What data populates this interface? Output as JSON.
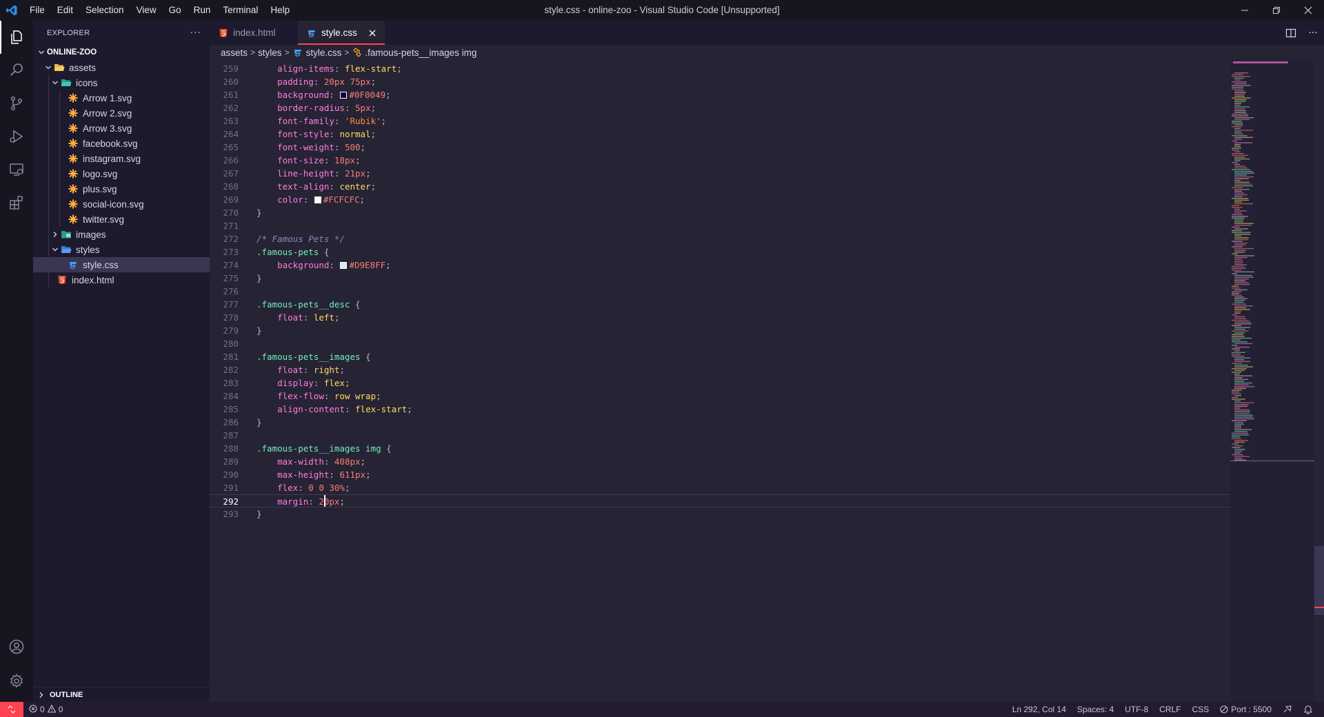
{
  "window": {
    "title": "style.css - online-zoo - Visual Studio Code [Unsupported]",
    "menu": [
      "File",
      "Edit",
      "Selection",
      "View",
      "Go",
      "Run",
      "Terminal",
      "Help"
    ]
  },
  "colors": {
    "accent": "#fe4450",
    "background": "#262335",
    "sidebar": "#1e1a2e",
    "activitybar": "#171520"
  },
  "sidebar": {
    "title": "EXPLORER",
    "root": "ONLINE-ZOO",
    "tree": {
      "assets": "assets",
      "icons": "icons",
      "icon_files": [
        "Arrow 1.svg",
        "Arrow 2.svg",
        "Arrow 3.svg",
        "facebook.svg",
        "instagram.svg",
        "logo.svg",
        "plus.svg",
        "social-icon.svg",
        "twitter.svg"
      ],
      "images": "images",
      "styles": "styles",
      "style_file": "style.css",
      "index_file": "index.html"
    },
    "outline": "OUTLINE"
  },
  "tabs": [
    {
      "label": "index.html",
      "active": false
    },
    {
      "label": "style.css",
      "active": true
    }
  ],
  "breadcrumb": [
    "assets",
    "styles",
    "style.css",
    ".famous-pets__images img"
  ],
  "editor": {
    "current_line": 292,
    "lines": [
      {
        "n": 259,
        "tokens": [
          {
            "t": "    "
          },
          {
            "t": "align-items",
            "c": "prop"
          },
          {
            "t": ": ",
            "c": "punc"
          },
          {
            "t": "flex-start",
            "c": "val"
          },
          {
            "t": ";",
            "c": "punc"
          }
        ]
      },
      {
        "n": 260,
        "tokens": [
          {
            "t": "    "
          },
          {
            "t": "padding",
            "c": "prop"
          },
          {
            "t": ": ",
            "c": "punc"
          },
          {
            "t": "20px 75px",
            "c": "num"
          },
          {
            "t": ";",
            "c": "punc"
          }
        ]
      },
      {
        "n": 261,
        "tokens": [
          {
            "t": "    "
          },
          {
            "t": "background",
            "c": "prop"
          },
          {
            "t": ": ",
            "c": "punc"
          },
          {
            "swatch": "#0F0049"
          },
          {
            "t": "#0F0049",
            "c": "num"
          },
          {
            "t": ";",
            "c": "punc"
          }
        ]
      },
      {
        "n": 262,
        "tokens": [
          {
            "t": "    "
          },
          {
            "t": "border-radius",
            "c": "prop"
          },
          {
            "t": ": ",
            "c": "punc"
          },
          {
            "t": "5px",
            "c": "num"
          },
          {
            "t": ";",
            "c": "punc"
          }
        ]
      },
      {
        "n": 263,
        "tokens": [
          {
            "t": "    "
          },
          {
            "t": "font-family",
            "c": "prop"
          },
          {
            "t": ": ",
            "c": "punc"
          },
          {
            "t": "'Rubik'",
            "c": "str"
          },
          {
            "t": ";",
            "c": "punc"
          }
        ]
      },
      {
        "n": 264,
        "tokens": [
          {
            "t": "    "
          },
          {
            "t": "font-style",
            "c": "prop"
          },
          {
            "t": ": ",
            "c": "punc"
          },
          {
            "t": "normal",
            "c": "val"
          },
          {
            "t": ";",
            "c": "punc"
          }
        ]
      },
      {
        "n": 265,
        "tokens": [
          {
            "t": "    "
          },
          {
            "t": "font-weight",
            "c": "prop"
          },
          {
            "t": ": ",
            "c": "punc"
          },
          {
            "t": "500",
            "c": "num"
          },
          {
            "t": ";",
            "c": "punc"
          }
        ]
      },
      {
        "n": 266,
        "tokens": [
          {
            "t": "    "
          },
          {
            "t": "font-size",
            "c": "prop"
          },
          {
            "t": ": ",
            "c": "punc"
          },
          {
            "t": "18px",
            "c": "num"
          },
          {
            "t": ";",
            "c": "punc"
          }
        ]
      },
      {
        "n": 267,
        "tokens": [
          {
            "t": "    "
          },
          {
            "t": "line-height",
            "c": "prop"
          },
          {
            "t": ": ",
            "c": "punc"
          },
          {
            "t": "21px",
            "c": "num"
          },
          {
            "t": ";",
            "c": "punc"
          }
        ]
      },
      {
        "n": 268,
        "tokens": [
          {
            "t": "    "
          },
          {
            "t": "text-align",
            "c": "prop"
          },
          {
            "t": ": ",
            "c": "punc"
          },
          {
            "t": "center",
            "c": "val"
          },
          {
            "t": ";",
            "c": "punc"
          }
        ]
      },
      {
        "n": 269,
        "tokens": [
          {
            "t": "    "
          },
          {
            "t": "color",
            "c": "prop"
          },
          {
            "t": ": ",
            "c": "punc"
          },
          {
            "swatch": "#FCFCFC"
          },
          {
            "t": "#FCFCFC",
            "c": "num"
          },
          {
            "t": ";",
            "c": "punc"
          }
        ]
      },
      {
        "n": 270,
        "tokens": [
          {
            "t": "}",
            "c": "punc"
          }
        ]
      },
      {
        "n": 271,
        "tokens": []
      },
      {
        "n": 272,
        "tokens": [
          {
            "t": "/* Famous Pets */",
            "c": "com"
          }
        ]
      },
      {
        "n": 273,
        "tokens": [
          {
            "t": ".famous-pets",
            "c": "sel"
          },
          {
            "t": " {",
            "c": "punc"
          }
        ]
      },
      {
        "n": 274,
        "tokens": [
          {
            "t": "    "
          },
          {
            "t": "background",
            "c": "prop"
          },
          {
            "t": ": ",
            "c": "punc"
          },
          {
            "swatch": "#D9E8FF"
          },
          {
            "t": "#D9E8FF",
            "c": "num"
          },
          {
            "t": ";",
            "c": "punc"
          }
        ]
      },
      {
        "n": 275,
        "tokens": [
          {
            "t": "}",
            "c": "punc"
          }
        ]
      },
      {
        "n": 276,
        "tokens": []
      },
      {
        "n": 277,
        "tokens": [
          {
            "t": ".famous-pets__desc",
            "c": "sel"
          },
          {
            "t": " {",
            "c": "punc"
          }
        ]
      },
      {
        "n": 278,
        "tokens": [
          {
            "t": "    "
          },
          {
            "t": "float",
            "c": "prop"
          },
          {
            "t": ": ",
            "c": "punc"
          },
          {
            "t": "left",
            "c": "val"
          },
          {
            "t": ";",
            "c": "punc"
          }
        ]
      },
      {
        "n": 279,
        "tokens": [
          {
            "t": "}",
            "c": "punc"
          }
        ]
      },
      {
        "n": 280,
        "tokens": []
      },
      {
        "n": 281,
        "tokens": [
          {
            "t": ".famous-pets__images",
            "c": "sel"
          },
          {
            "t": " {",
            "c": "punc"
          }
        ]
      },
      {
        "n": 282,
        "tokens": [
          {
            "t": "    "
          },
          {
            "t": "float",
            "c": "prop"
          },
          {
            "t": ": ",
            "c": "punc"
          },
          {
            "t": "right",
            "c": "val"
          },
          {
            "t": ";",
            "c": "punc"
          }
        ]
      },
      {
        "n": 283,
        "tokens": [
          {
            "t": "    "
          },
          {
            "t": "display",
            "c": "prop"
          },
          {
            "t": ": ",
            "c": "punc"
          },
          {
            "t": "flex",
            "c": "val"
          },
          {
            "t": ";",
            "c": "punc"
          }
        ]
      },
      {
        "n": 284,
        "tokens": [
          {
            "t": "    "
          },
          {
            "t": "flex-flow",
            "c": "prop"
          },
          {
            "t": ": ",
            "c": "punc"
          },
          {
            "t": "row wrap",
            "c": "val"
          },
          {
            "t": ";",
            "c": "punc"
          }
        ]
      },
      {
        "n": 285,
        "tokens": [
          {
            "t": "    "
          },
          {
            "t": "align-content",
            "c": "prop"
          },
          {
            "t": ": ",
            "c": "punc"
          },
          {
            "t": "flex-start",
            "c": "val"
          },
          {
            "t": ";",
            "c": "punc"
          }
        ]
      },
      {
        "n": 286,
        "tokens": [
          {
            "t": "}",
            "c": "punc"
          }
        ]
      },
      {
        "n": 287,
        "tokens": []
      },
      {
        "n": 288,
        "tokens": [
          {
            "t": ".famous-pets__images",
            "c": "sel"
          },
          {
            "t": " "
          },
          {
            "t": "img",
            "c": "tag"
          },
          {
            "t": " {",
            "c": "punc"
          }
        ]
      },
      {
        "n": 289,
        "tokens": [
          {
            "t": "    "
          },
          {
            "t": "max-width",
            "c": "prop"
          },
          {
            "t": ": ",
            "c": "punc"
          },
          {
            "t": "408px",
            "c": "num"
          },
          {
            "t": ";",
            "c": "punc"
          }
        ]
      },
      {
        "n": 290,
        "tokens": [
          {
            "t": "    "
          },
          {
            "t": "max-height",
            "c": "prop"
          },
          {
            "t": ": ",
            "c": "punc"
          },
          {
            "t": "611px",
            "c": "num"
          },
          {
            "t": ";",
            "c": "punc"
          }
        ]
      },
      {
        "n": 291,
        "tokens": [
          {
            "t": "    "
          },
          {
            "t": "flex",
            "c": "prop"
          },
          {
            "t": ": ",
            "c": "punc"
          },
          {
            "t": "0 0 30%",
            "c": "num"
          },
          {
            "t": ";",
            "c": "punc"
          }
        ]
      },
      {
        "n": 292,
        "tokens": [
          {
            "t": "    "
          },
          {
            "t": "margin",
            "c": "prop"
          },
          {
            "t": ": ",
            "c": "punc"
          },
          {
            "t": "20px",
            "c": "num"
          },
          {
            "t": ";",
            "c": "punc"
          }
        ]
      },
      {
        "n": 293,
        "tokens": [
          {
            "t": "}",
            "c": "punc"
          }
        ]
      }
    ]
  },
  "status": {
    "errors": "0",
    "warnings": "0",
    "position": "Ln 292, Col 14",
    "spaces": "Spaces: 4",
    "encoding": "UTF-8",
    "eol": "CRLF",
    "language": "CSS",
    "port": "Port : 5500"
  }
}
